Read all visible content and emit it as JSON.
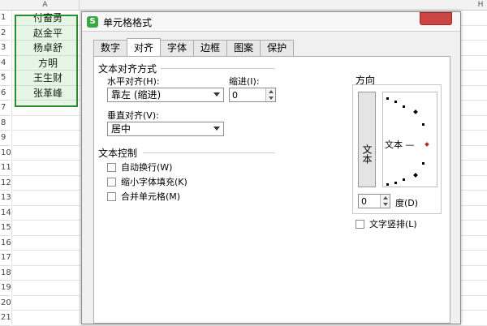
{
  "sheet": {
    "col_a": "A",
    "col_h": "H",
    "rows": [
      "1",
      "2",
      "3",
      "4",
      "5",
      "6",
      "7",
      "8",
      "9",
      "10",
      "11",
      "12",
      "13",
      "14",
      "15",
      "16",
      "17",
      "18",
      "19",
      "20",
      "21"
    ],
    "names": [
      "付畜勇",
      "赵金平",
      "杨卓舒",
      "方明",
      "王生财",
      "张革峰"
    ]
  },
  "dialog": {
    "title": "单元格格式",
    "tabs": [
      "数字",
      "对齐",
      "字体",
      "边框",
      "图案",
      "保护"
    ],
    "active_tab": "对齐",
    "text_align_section": "文本对齐方式",
    "horizontal_label": "水平对齐(H):",
    "horizontal_value": "靠左 (缩进)",
    "indent_label": "缩进(I):",
    "indent_value": "0",
    "vertical_label": "垂直对齐(V):",
    "vertical_value": "居中",
    "text_control_section": "文本控制",
    "wrap_text": "自动换行(W)",
    "shrink_to_fit": "缩小字体填充(K)",
    "merge_cells": "合并单元格(M)",
    "direction_section": "方向",
    "vertical_text_button": "文本",
    "dial_text": "文本 —",
    "degree_value": "0",
    "degree_label": "度(D)",
    "vertical_text_checkbox": "文字竖排(L)"
  },
  "colors": {
    "selection_border": "#2e8b2e",
    "close_button": "#c44444"
  }
}
